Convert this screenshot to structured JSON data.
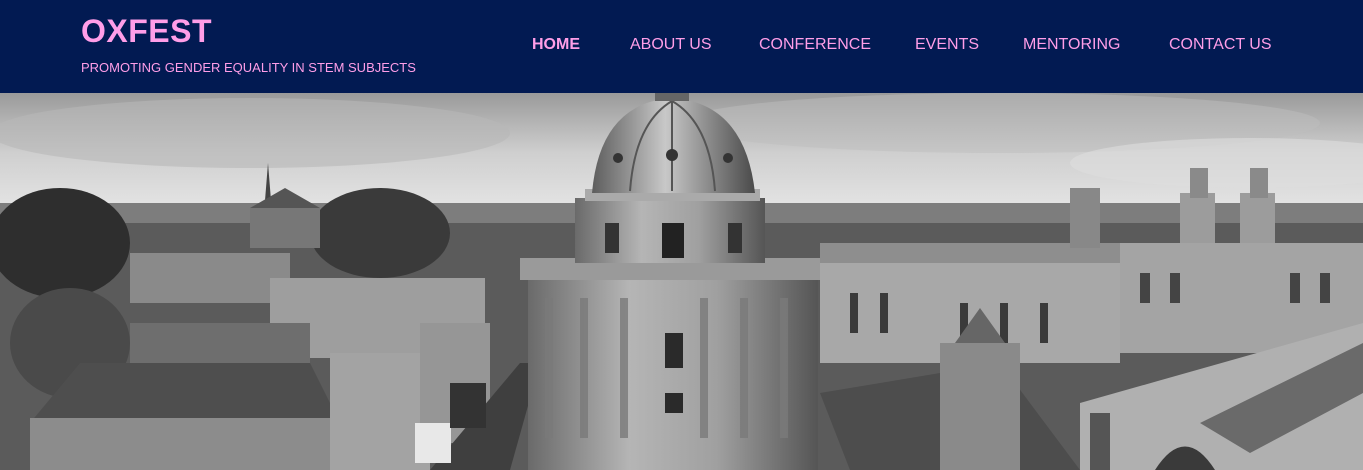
{
  "site": {
    "title": "OXFEST",
    "tagline": "PROMOTING GENDER EQUALITY IN STEM SUBJECTS"
  },
  "nav": {
    "items": [
      {
        "label": "HOME",
        "active": true
      },
      {
        "label": "ABOUT US",
        "active": false
      },
      {
        "label": "CONFERENCE",
        "active": false
      },
      {
        "label": "EVENTS",
        "active": false
      },
      {
        "label": "MENTORING",
        "active": false
      },
      {
        "label": "CONTACT US",
        "active": false
      }
    ]
  },
  "colors": {
    "header_bg": "#021a52",
    "accent": "#ff9ee8"
  }
}
